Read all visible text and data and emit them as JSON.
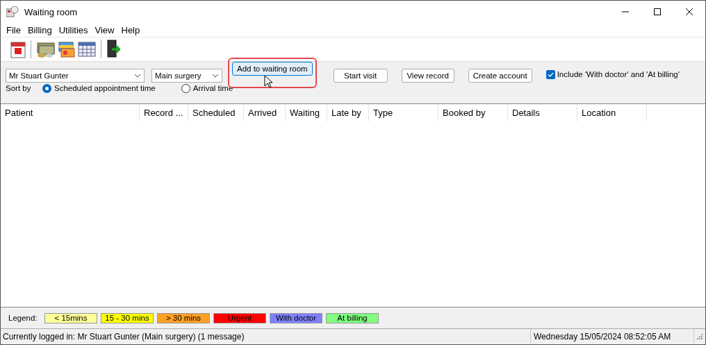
{
  "window": {
    "title": "Waiting room"
  },
  "menu": [
    "File",
    "Billing",
    "Utilities",
    "View",
    "Help"
  ],
  "toolbar": [
    {
      "kind": "calendar"
    },
    {
      "kind": "separator"
    },
    {
      "kind": "money"
    },
    {
      "kind": "cards"
    },
    {
      "kind": "grid"
    },
    {
      "kind": "separator"
    },
    {
      "kind": "exit"
    }
  ],
  "doctor_select": {
    "value": "Mr Stuart Gunter"
  },
  "location_select": {
    "value": "Main surgery"
  },
  "buttons": [
    {
      "label": "Add to waiting room",
      "highlighted": true
    },
    {
      "label": "Start visit",
      "highlighted": false
    },
    {
      "label": "View record",
      "highlighted": false
    },
    {
      "label": "Create account",
      "highlighted": false
    }
  ],
  "include_checkbox": {
    "label": "Include 'With doctor' and 'At billing'",
    "checked": true
  },
  "sort": {
    "label": "Sort by",
    "options": [
      {
        "label": "Scheduled appointment time",
        "selected": true
      },
      {
        "label": "Arrival time",
        "selected": false
      }
    ]
  },
  "table": {
    "columns": [
      "Patient",
      "Record ...",
      "Scheduled",
      "Arrived",
      "Waiting",
      "Late by",
      "Type",
      "Booked by",
      "Details",
      "Location"
    ]
  },
  "legend": {
    "label": "Legend:",
    "items": [
      {
        "label": "< 15mins",
        "color": "#ffff99"
      },
      {
        "label": "15 - 30 mins",
        "color": "#ffff00"
      },
      {
        "label": "> 30 mins",
        "color": "#ffa024"
      },
      {
        "label": "Urgent",
        "color": "#ff0000"
      },
      {
        "label": "With doctor",
        "color": "#8080ff"
      },
      {
        "label": "At billing",
        "color": "#80ff80"
      }
    ]
  },
  "status_bar": {
    "message": "Currently logged in:  Mr Stuart Gunter (Main surgery) (1 message)",
    "datetime": "Wednesday 15/05/2024 08:52:05 AM"
  }
}
